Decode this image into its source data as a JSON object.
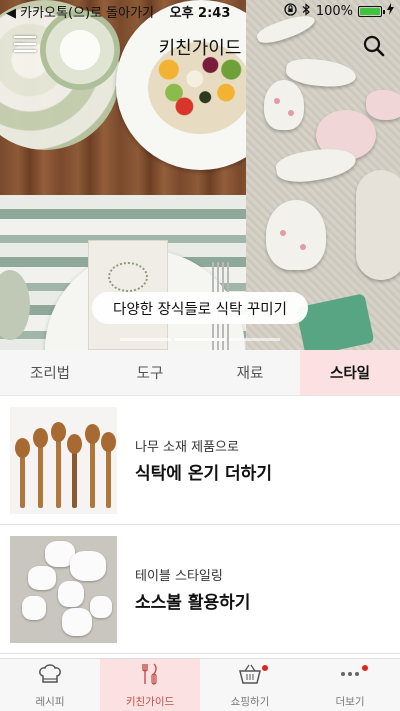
{
  "status_bar": {
    "back_text": "◀ 카카오톡(으)로 돌아가기",
    "time": "오후 2:43",
    "battery_text": "100%",
    "battery_level": 1.0
  },
  "nav": {
    "title": "키친가이드",
    "menu_icon": "hamburger-menu-icon",
    "search_icon": "search-icon"
  },
  "hero": {
    "caption": "다양한 장식들로 식탁 꾸미기",
    "pages": 3,
    "active_page": 2
  },
  "tabs": [
    {
      "label": "조리법",
      "active": false
    },
    {
      "label": "도구",
      "active": false
    },
    {
      "label": "재료",
      "active": false
    },
    {
      "label": "스타일",
      "active": true
    }
  ],
  "items": [
    {
      "subtitle": "나무 소재 제품으로",
      "title": "식탁에 온기 더하기",
      "thumb": "wooden-spoons"
    },
    {
      "subtitle": "테이블 스타일링",
      "title": "소스볼 활용하기",
      "thumb": "sauce-bowls"
    }
  ],
  "tabbar": [
    {
      "label": "레시피",
      "icon": "chef-hat-icon",
      "active": false,
      "badge": false
    },
    {
      "label": "키친가이드",
      "icon": "kitchen-utensils-icon",
      "active": true,
      "badge": false
    },
    {
      "label": "쇼핑하기",
      "icon": "shopping-basket-icon",
      "active": false,
      "badge": true
    },
    {
      "label": "더보기",
      "icon": "more-dots-icon",
      "active": false,
      "badge": true
    }
  ],
  "colors": {
    "accent_pink": "#fbe1e1",
    "active_label": "#c0504d",
    "badge_red": "#e0231c",
    "battery_green": "#3fc43f"
  }
}
